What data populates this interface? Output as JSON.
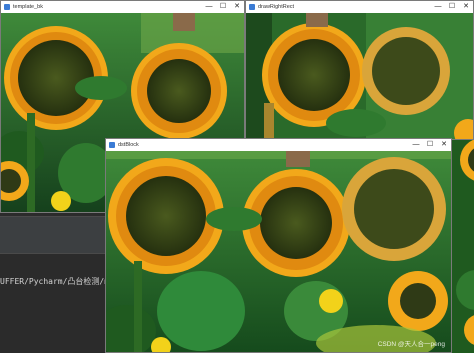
{
  "windows": {
    "template": {
      "title": "template_bk"
    },
    "draw": {
      "title": "drawRightRect"
    },
    "dst": {
      "title": "dstBlock"
    }
  },
  "window_controls": {
    "minimize": "—",
    "maximize": "☐",
    "close": "✕"
  },
  "terminal": {
    "path_text": "UFFER/Pycharm/凸台检测/matc"
  },
  "watermark": "CSDN @天人合一peng",
  "icons": {
    "window": "app-window-icon"
  },
  "colors": {
    "leaf_dark": "#0f3d1a",
    "leaf_mid": "#2f7a2f",
    "petal": "#f2a81a",
    "seed": "#2f3a16",
    "ide_bg": "#2b2b2b"
  }
}
